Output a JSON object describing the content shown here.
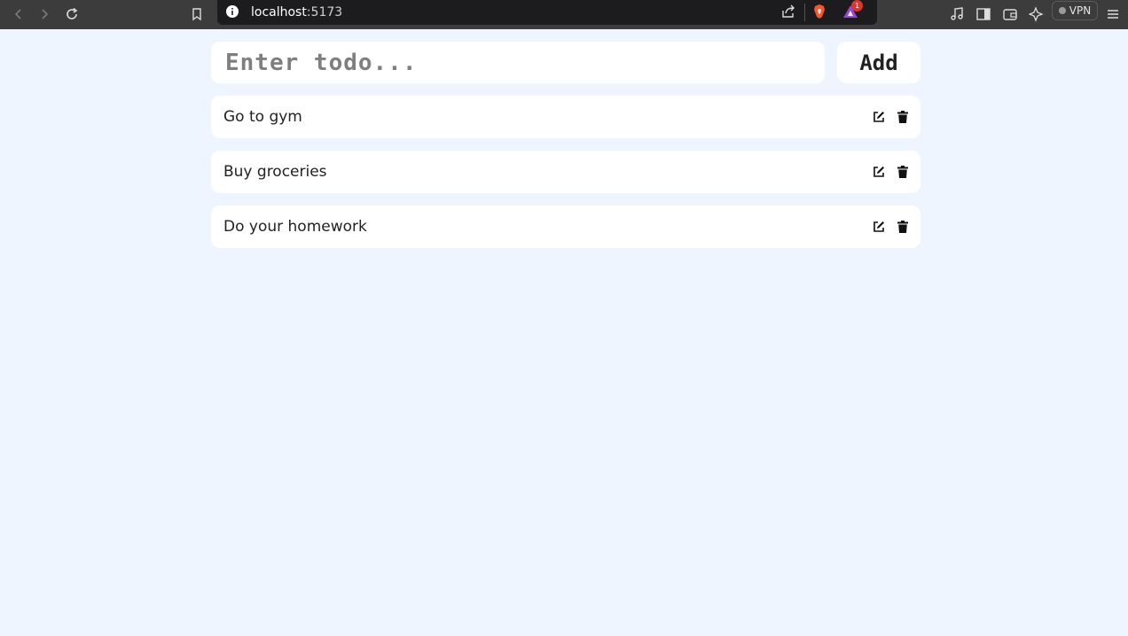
{
  "browser": {
    "url_host": "localhost",
    "url_port": ":5173",
    "notification_count": "1",
    "vpn_label": "VPN",
    "icons": [
      "back-icon",
      "forward-icon",
      "reload-icon",
      "bookmark-icon",
      "info-icon",
      "share-icon",
      "brave-shields-icon",
      "rewards-icon",
      "media-icon",
      "sidebar-icon",
      "wallet-icon",
      "leo-ai-icon",
      "menu-icon"
    ]
  },
  "todo_form": {
    "placeholder": "Enter todo...",
    "add_label": "Add"
  },
  "todos": [
    {
      "text": "Go to gym"
    },
    {
      "text": "Buy groceries"
    },
    {
      "text": "Do your homework"
    }
  ]
}
